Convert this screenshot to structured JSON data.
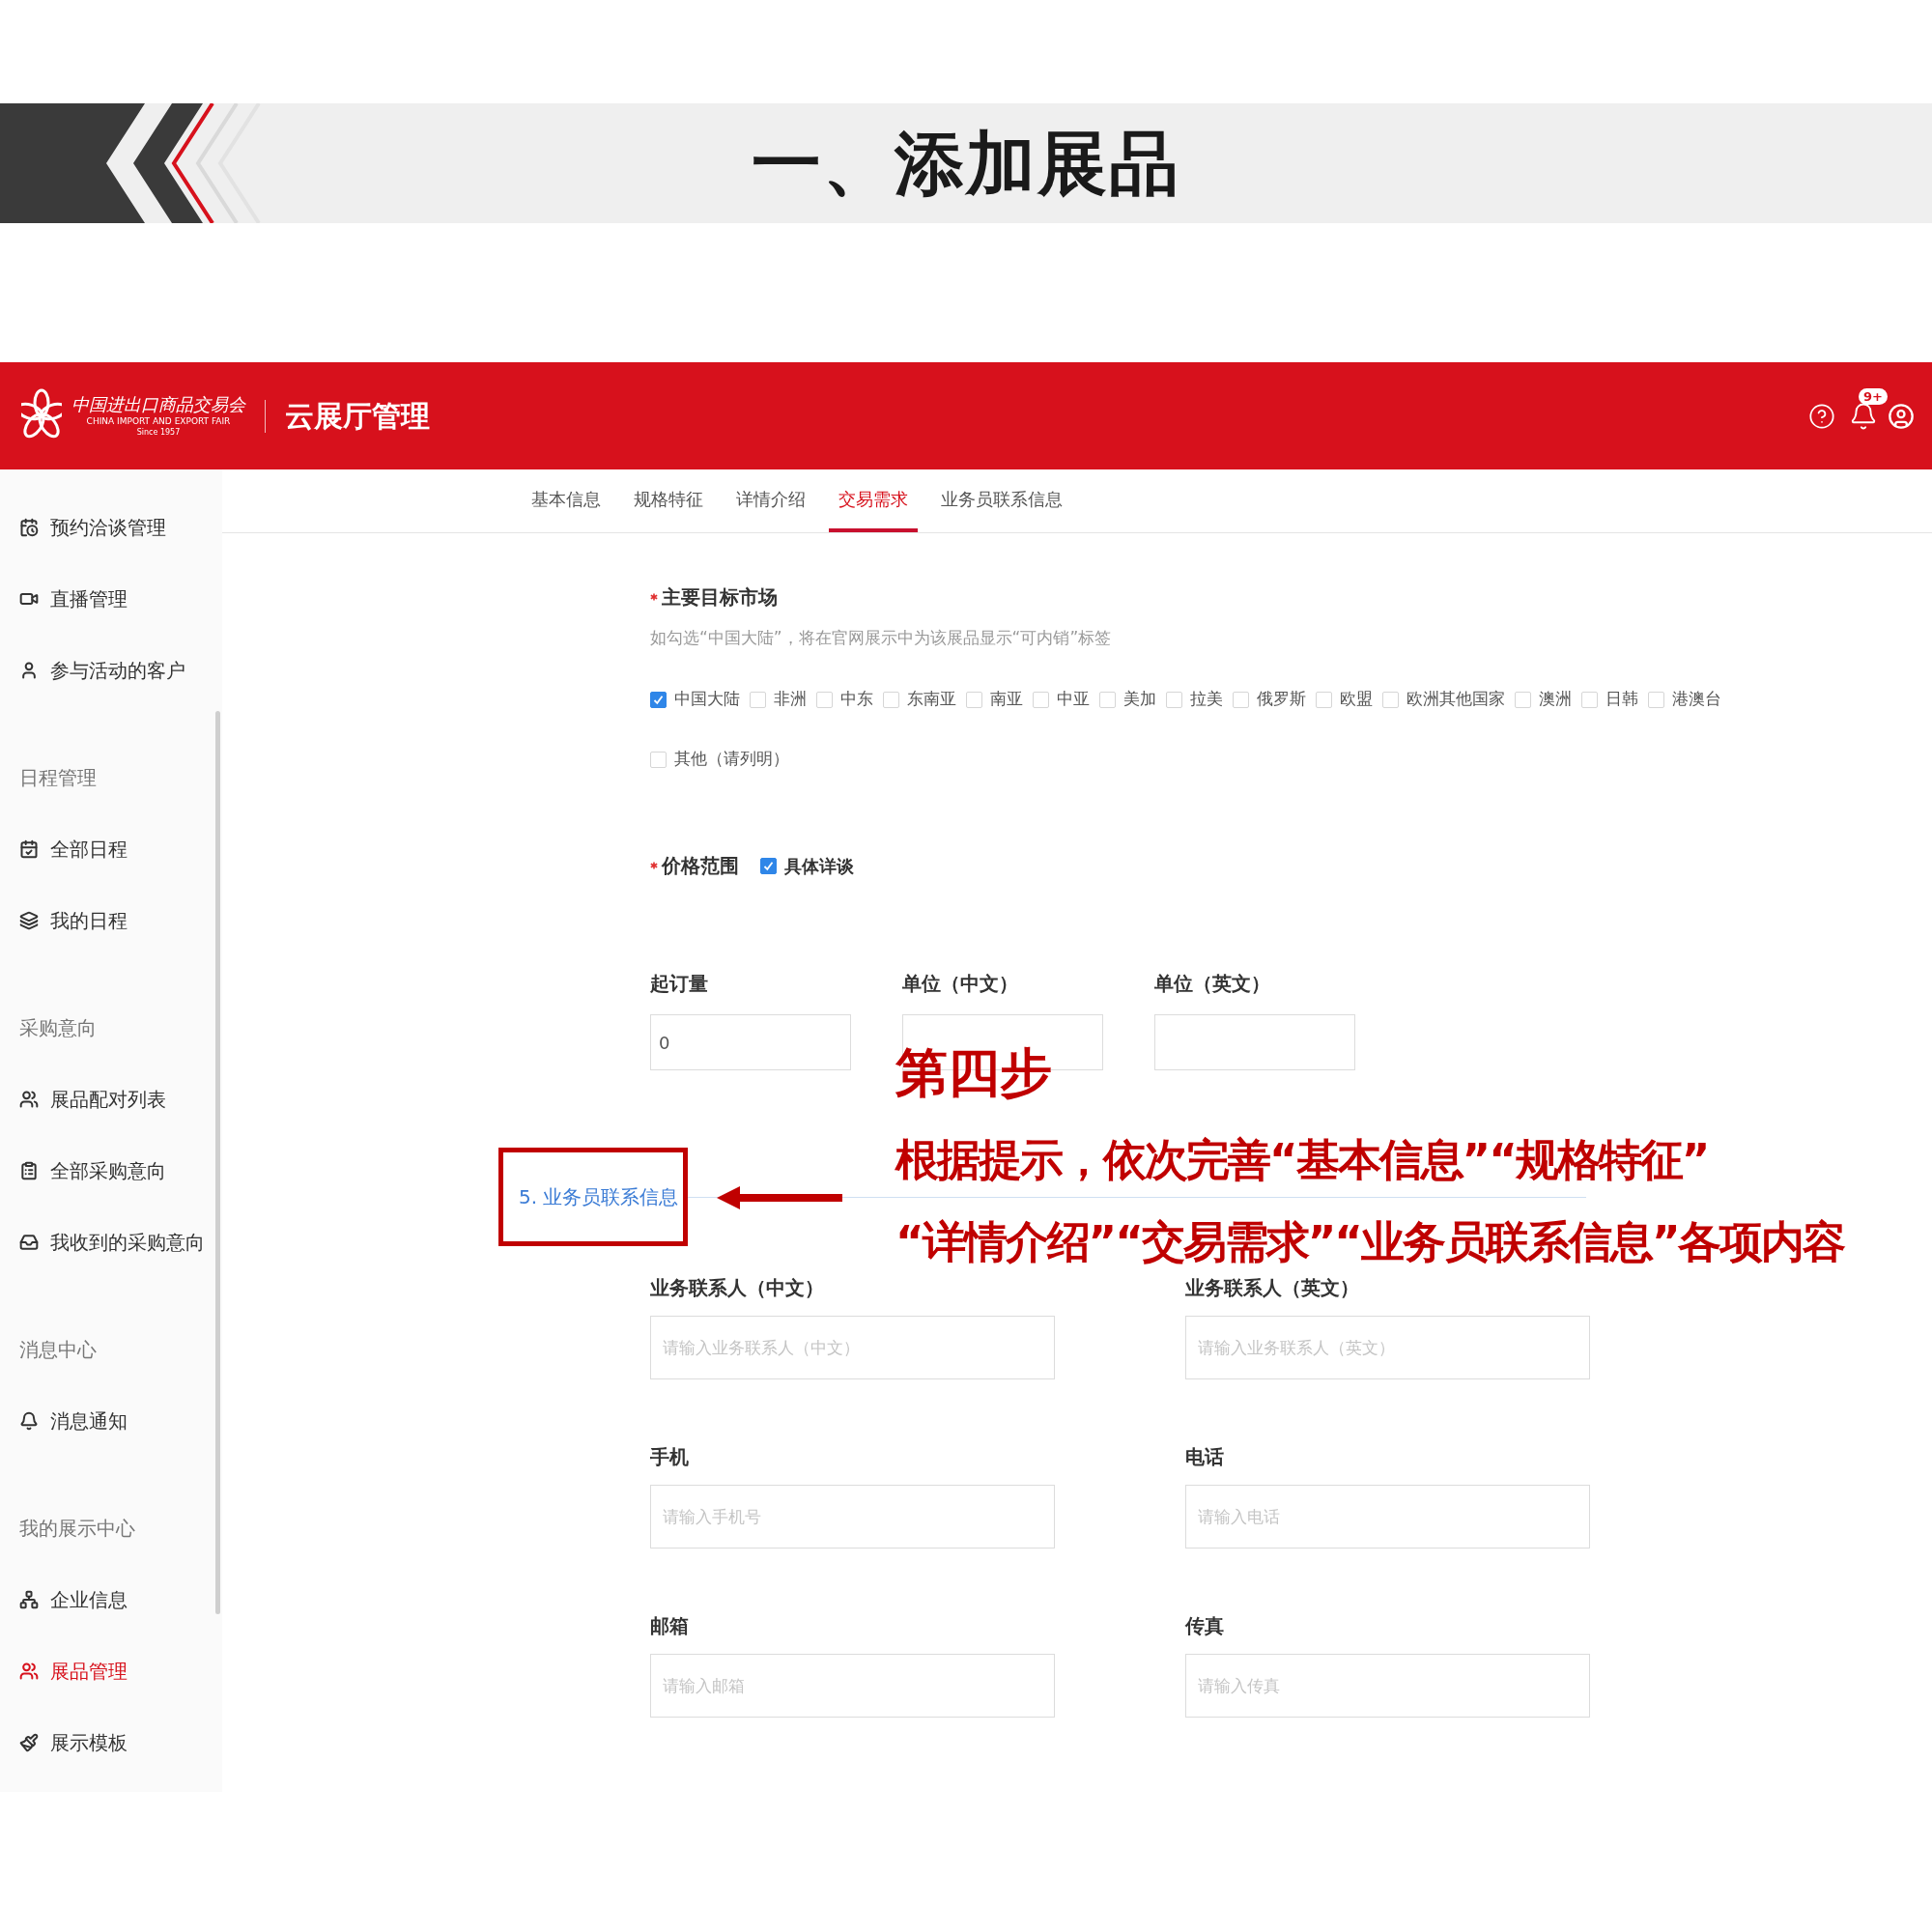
{
  "slide": {
    "title": "一、添加展品"
  },
  "header": {
    "logo_cn": "中国进出口商品交易会",
    "logo_en": "CHINA IMPORT AND EXPORT FAIR",
    "logo_since": "Since 1957",
    "app_title": "云展厅管理",
    "notification_badge": "9+"
  },
  "sidebar": {
    "groups": [
      {
        "items": [
          {
            "label": "预约洽谈管理",
            "selected": false
          },
          {
            "label": "直播管理",
            "selected": false
          },
          {
            "label": "参与活动的客户",
            "selected": false
          }
        ]
      },
      {
        "heading": "日程管理",
        "items": [
          {
            "label": "全部日程",
            "selected": false
          },
          {
            "label": "我的日程",
            "selected": false
          }
        ]
      },
      {
        "heading": "采购意向",
        "items": [
          {
            "label": "展品配对列表",
            "selected": false
          },
          {
            "label": "全部采购意向",
            "selected": false
          },
          {
            "label": "我收到的采购意向",
            "selected": false
          }
        ]
      },
      {
        "heading": "消息中心",
        "items": [
          {
            "label": "消息通知",
            "selected": false
          }
        ]
      },
      {
        "heading": "我的展示中心",
        "items": [
          {
            "label": "企业信息",
            "selected": false
          },
          {
            "label": "展品管理",
            "selected": true
          },
          {
            "label": "展示模板",
            "selected": false
          }
        ]
      }
    ]
  },
  "tabs": [
    {
      "label": "基本信息",
      "selected": false
    },
    {
      "label": "规格特征",
      "selected": false
    },
    {
      "label": "详情介绍",
      "selected": false
    },
    {
      "label": "交易需求",
      "selected": true
    },
    {
      "label": "业务员联系信息",
      "selected": false
    }
  ],
  "market": {
    "label": "主要目标市场",
    "hint": "如勾选“中国大陆”，将在官网展示中为该展品显示“可内销”标签",
    "options": [
      {
        "label": "中国大陆",
        "checked": true
      },
      {
        "label": "非洲",
        "checked": false
      },
      {
        "label": "中东",
        "checked": false
      },
      {
        "label": "东南亚",
        "checked": false
      },
      {
        "label": "南亚",
        "checked": false
      },
      {
        "label": "中亚",
        "checked": false
      },
      {
        "label": "美加",
        "checked": false
      },
      {
        "label": "拉美",
        "checked": false
      },
      {
        "label": "俄罗斯",
        "checked": false
      },
      {
        "label": "欧盟",
        "checked": false
      },
      {
        "label": "欧洲其他国家",
        "checked": false
      },
      {
        "label": "澳洲",
        "checked": false
      },
      {
        "label": "日韩",
        "checked": false
      },
      {
        "label": "港澳台",
        "checked": false
      }
    ],
    "other_option": {
      "label": "其他（请列明）",
      "checked": false
    }
  },
  "price": {
    "label": "价格范围",
    "option": {
      "label": "具体详谈",
      "checked": true
    }
  },
  "order_fields": [
    {
      "label": "起订量",
      "value": "0"
    },
    {
      "label": "单位（中文）"
    },
    {
      "label": "单位（英文）"
    }
  ],
  "section": {
    "title": "5. 业务员联系信息"
  },
  "contact_fields": [
    {
      "label": "业务联系人（中文）",
      "placeholder": "请输入业务联系人（中文）"
    },
    {
      "label": "业务联系人（英文）",
      "placeholder": "请输入业务联系人（英文）"
    },
    {
      "label": "手机",
      "placeholder": "请输入手机号"
    },
    {
      "label": "电话",
      "placeholder": "请输入电话"
    },
    {
      "label": "邮箱",
      "placeholder": "请输入邮箱"
    },
    {
      "label": "传真",
      "placeholder": "请输入传真"
    }
  ],
  "annotation": {
    "step": "第四步",
    "lines": [
      "根据提示，依次完善“基本信息”“规格特征”",
      "“详情介绍”“交易需求”“业务员联系信息”各项内容"
    ]
  }
}
